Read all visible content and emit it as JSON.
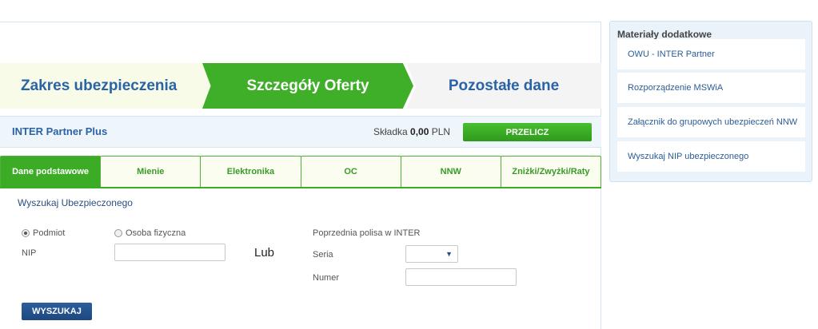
{
  "steps": {
    "step1": "Zakres ubezpieczenia",
    "step2": "Szczegóły Oferty",
    "step3": "Pozostałe dane"
  },
  "product": {
    "name": "INTER Partner Plus",
    "premium_label": "Składka",
    "premium_value": "0,00",
    "premium_currency": "PLN",
    "recalc_label": "PRZELICZ"
  },
  "tabs": [
    {
      "label": "Dane podstawowe",
      "active": true
    },
    {
      "label": "Mienie"
    },
    {
      "label": "Elektronika"
    },
    {
      "label": "OC"
    },
    {
      "label": "NNW"
    },
    {
      "label": "Zniżki/Zwyżki/Raty"
    }
  ],
  "search": {
    "title": "Wyszukaj Ubezpieczonego",
    "radio_entity": "Podmiot",
    "radio_person": "Osoba fizyczna",
    "nip_label": "NIP",
    "nip_value": "",
    "or_label": "Lub",
    "previous_policy_label": "Poprzednia polisa w INTER",
    "series_label": "Seria",
    "series_value": "",
    "number_label": "Numer",
    "number_value": "",
    "button_label": "WYSZUKAJ"
  },
  "side": {
    "title": "Materiały dodatkowe",
    "items": [
      "OWU - INTER Partner",
      "Rozporządzenie MSWiA",
      "Załącznik do grupowych ubezpieczeń NNW",
      "Wyszukaj NIP ubezpieczonego"
    ]
  },
  "colors": {
    "accent_green": "#3cab26",
    "brand_blue": "#2a64a6",
    "button_blue": "#1d4880"
  }
}
